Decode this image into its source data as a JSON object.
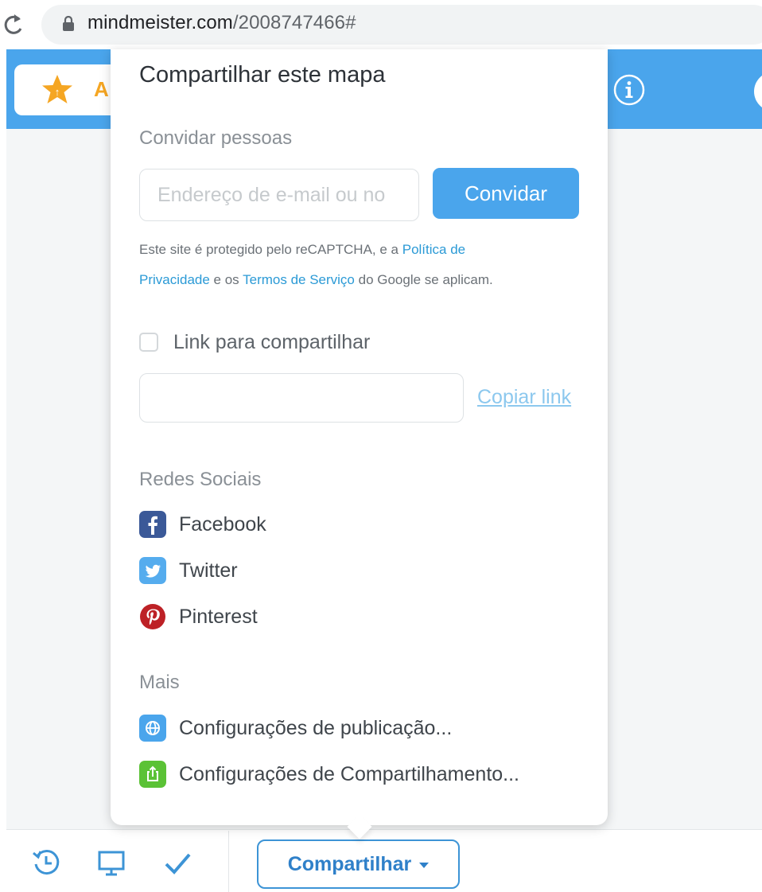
{
  "browser": {
    "url_host": "mindmeister.com",
    "url_path": "/2008747466#"
  },
  "header": {
    "upgrade_label": "A"
  },
  "share_popover": {
    "title": "Compartilhar este mapa",
    "invite": {
      "heading": "Convidar pessoas",
      "email_placeholder": "Endereço de e-mail ou no",
      "button_label": "Convidar",
      "captcha": {
        "prefix": "Este site é protegido pelo reCAPTCHA, e a ",
        "privacy_link_line1": "Política de",
        "privacy_link_line2": "Privacidade",
        "middle": " e os ",
        "terms_link": "Termos de Serviço",
        "suffix": " do Google se aplicam."
      }
    },
    "share_link": {
      "checkbox_label": "Link para compartilhar",
      "link_value": "",
      "copy_label": "Copiar link"
    },
    "social": {
      "heading": "Redes Sociais",
      "items": [
        {
          "label": "Facebook",
          "icon": "facebook-icon",
          "color": "#3b5998"
        },
        {
          "label": "Twitter",
          "icon": "twitter-icon",
          "color": "#55acee"
        },
        {
          "label": "Pinterest",
          "icon": "pinterest-icon",
          "color": "#bd2126"
        }
      ]
    },
    "more": {
      "heading": "Mais",
      "items": [
        {
          "label": "Configurações de publicação...",
          "icon": "globe-icon",
          "color": "#4aa5ec"
        },
        {
          "label": "Configurações de Compartilhamento...",
          "icon": "export-icon",
          "color": "#5bc236"
        }
      ]
    }
  },
  "toolbar": {
    "share_label": "Compartilhar"
  },
  "colors": {
    "accent": "#4aa5ec",
    "link": "#2b9ad6",
    "upgrade": "#f5a623"
  }
}
